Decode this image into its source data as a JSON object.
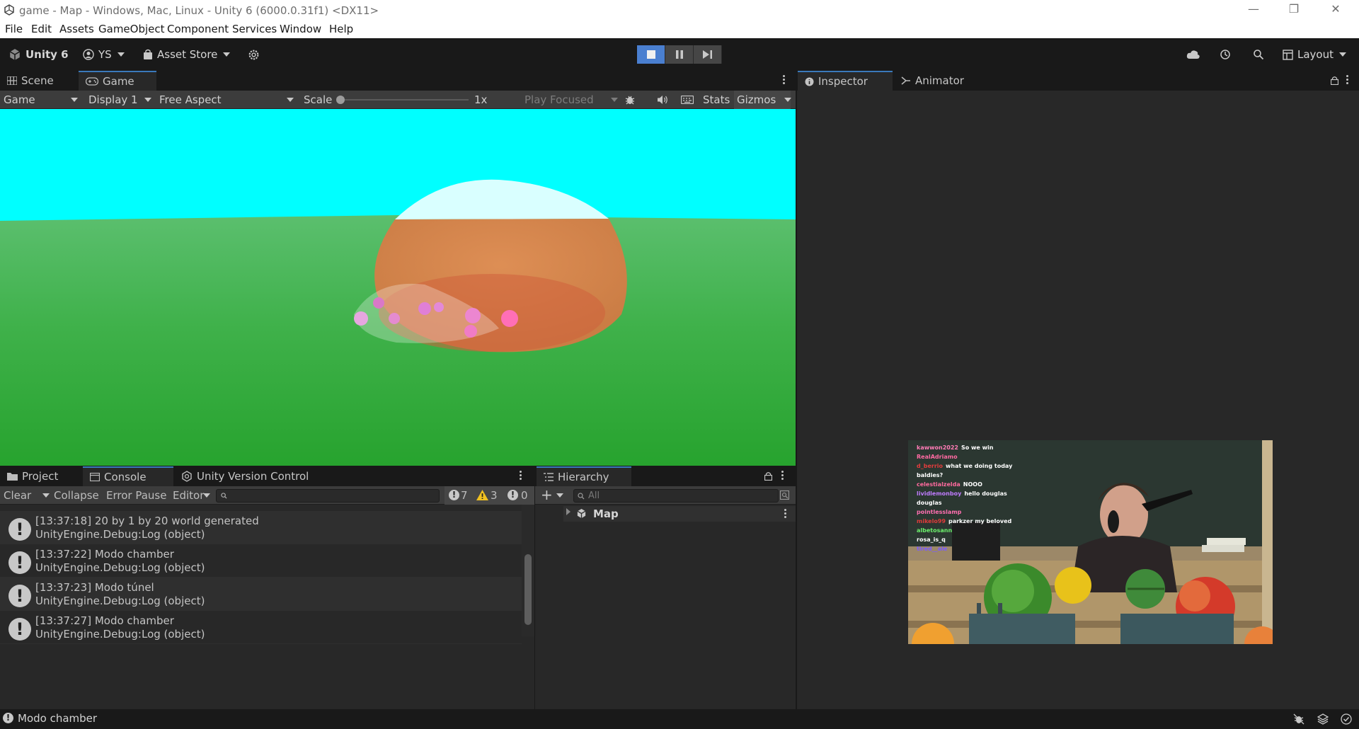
{
  "window": {
    "title": "game - Map - Windows, Mac, Linux - Unity 6 (6000.0.31f1) <DX11>"
  },
  "menu": [
    "File",
    "Edit",
    "Assets",
    "GameObject",
    "Component",
    "Services",
    "Window",
    "Help"
  ],
  "toolbar": {
    "unity_label": "Unity 6",
    "account_label": "YS",
    "asset_store_label": "Asset Store",
    "layout_label": "Layout"
  },
  "game_panel": {
    "tabs": [
      "Scene",
      "Game"
    ],
    "active_tab": "Game",
    "view_mode": "Game",
    "display": "Display 1",
    "aspect": "Free Aspect",
    "scale_label": "Scale",
    "scale_value": "1x",
    "play_mode": "Play Focused",
    "stats_label": "Stats",
    "gizmos_label": "Gizmos"
  },
  "console_panel": {
    "tabs": [
      "Project",
      "Console",
      "Unity Version Control"
    ],
    "active_tab": "Console",
    "clear_label": "Clear",
    "collapse_label": "Collapse",
    "error_pause_label": "Error Pause",
    "editor_label": "Editor",
    "log_count": "7",
    "warning_count": "3",
    "error_count": "0",
    "logs": [
      {
        "line1": "[13:37:18] 20 by 1 by 20 world generated",
        "line2": "UnityEngine.Debug:Log (object)"
      },
      {
        "line1": "[13:37:22] Modo chamber",
        "line2": "UnityEngine.Debug:Log (object)"
      },
      {
        "line1": "[13:37:23] Modo túnel",
        "line2": "UnityEngine.Debug:Log (object)"
      },
      {
        "line1": "[13:37:27] Modo chamber",
        "line2": "UnityEngine.Debug:Log (object)"
      }
    ]
  },
  "hierarchy_panel": {
    "tab": "Hierarchy",
    "search_placeholder": "All",
    "root_item": "Map"
  },
  "inspector_panel": {
    "tabs": [
      "Inspector",
      "Animator"
    ],
    "active_tab": "Inspector"
  },
  "stream_overlay": {
    "chat": [
      {
        "user": "kawwon2022",
        "msg": "So we win",
        "color": "#ff7cb6"
      },
      {
        "user": "RealAdriamo",
        "msg": "",
        "color": "#ff6aa2"
      },
      {
        "user": "d_berrio",
        "msg": "what we doing today",
        "color": "#e23c3c"
      },
      {
        "user": "",
        "msg": "baldies?",
        "color": "#ffffff"
      },
      {
        "user": "celestialzelda",
        "msg": "NOOO",
        "color": "#ff6a9e"
      },
      {
        "user": "lividlemonboy",
        "msg": "hello douglas douglas",
        "color": "#c07cff"
      },
      {
        "user": "pointlesslamp",
        "msg": "",
        "color": "#ff6fb0"
      },
      {
        "user": "mikelo99",
        "msg": "parkzer my beloved",
        "color": "#e03b3b"
      },
      {
        "user": "albetosann",
        "msg": "",
        "color": "#6cf06c"
      },
      {
        "user": "rosa_is_q",
        "msg": "",
        "color": "#ffffff"
      },
      {
        "user": "tired__ale",
        "msg": "",
        "color": "#7a5cff"
      }
    ]
  },
  "status": {
    "message": "Modo chamber"
  },
  "colors": {
    "sky": "#00ffff",
    "ground": "#3cb043",
    "accent": "#3a79bb",
    "play_active": "#4a7fd0"
  }
}
